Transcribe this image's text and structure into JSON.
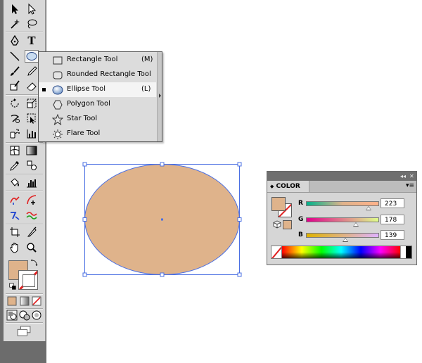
{
  "colors": {
    "fill": "#dfb38b",
    "selection": "#4a6fe3",
    "none_slash": "#e02020"
  },
  "toolbar": {
    "tools": [
      "selection-tool",
      "direct-selection-tool",
      "magic-wand-tool",
      "lasso-tool",
      "pen-tool",
      "type-tool",
      "line-segment-tool",
      "ellipse-tool",
      "paintbrush-tool",
      "pencil-tool",
      "blob-brush-tool",
      "eraser-tool",
      "rotate-tool",
      "scale-tool",
      "warp-tool",
      "free-transform-tool",
      "symbol-sprayer-tool",
      "column-graph-tool",
      "mesh-tool",
      "gradient-tool",
      "eyedropper-tool",
      "blend-tool",
      "live-paint-bucket-tool",
      "live-paint-selection-tool",
      "artboard-tool",
      "slice-tool",
      "hand-tool",
      "zoom-tool"
    ],
    "type_tool_glyph": "T"
  },
  "flyout": {
    "items": [
      {
        "label": "Rectangle Tool",
        "shortcut": "(M)",
        "icon": "rectangle-icon"
      },
      {
        "label": "Rounded Rectangle Tool",
        "shortcut": "",
        "icon": "rounded-rectangle-icon"
      },
      {
        "label": "Ellipse Tool",
        "shortcut": "(L)",
        "icon": "ellipse-icon"
      },
      {
        "label": "Polygon Tool",
        "shortcut": "",
        "icon": "polygon-icon"
      },
      {
        "label": "Star Tool",
        "shortcut": "",
        "icon": "star-icon"
      },
      {
        "label": "Flare Tool",
        "shortcut": "",
        "icon": "flare-icon"
      }
    ],
    "selected_index": 2
  },
  "color_panel": {
    "title": "COLOR",
    "tab_arrows": "◆",
    "collapse_glyph": "◂◂",
    "close_glyph": "✕",
    "menu_glyph": "▾≡",
    "channels": [
      {
        "label": "R",
        "value": "223",
        "level": 0.875
      },
      {
        "label": "G",
        "value": "178",
        "level": 0.698
      },
      {
        "label": "B",
        "value": "139",
        "level": 0.545
      }
    ]
  }
}
